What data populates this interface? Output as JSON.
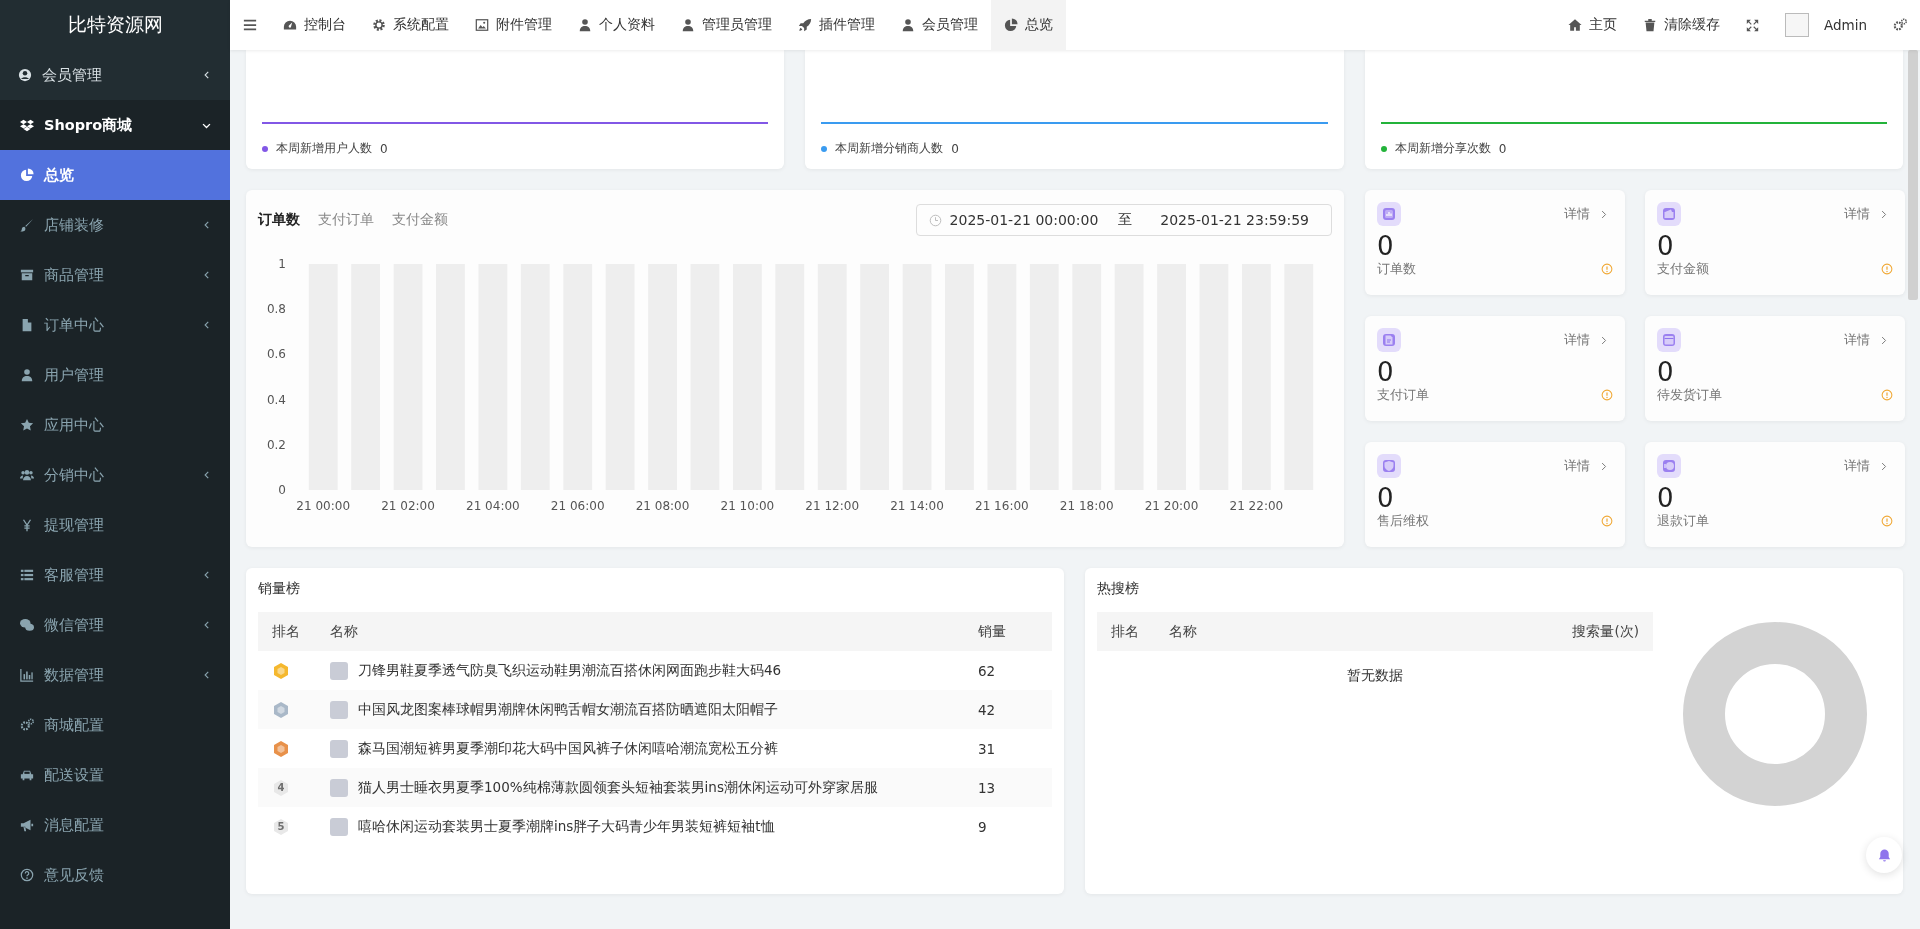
{
  "sidebar": {
    "logo": "比特资源网",
    "items": [
      {
        "label": "会员管理",
        "selected": false,
        "expanded": false
      },
      {
        "label": "Shopro商城",
        "selected": false,
        "expanded": true,
        "children": [
          {
            "label": "总览",
            "selected": true
          },
          {
            "label": "店铺装修",
            "selected": false,
            "expanded": false
          },
          {
            "label": "商品管理",
            "selected": false,
            "expanded": false
          },
          {
            "label": "订单中心",
            "selected": false,
            "expanded": false
          },
          {
            "label": "用户管理",
            "selected": false
          },
          {
            "label": "应用中心",
            "selected": false
          },
          {
            "label": "分销中心",
            "selected": false,
            "expanded": false
          },
          {
            "label": "提现管理",
            "selected": false
          },
          {
            "label": "客服管理",
            "selected": false,
            "expanded": false
          },
          {
            "label": "微信管理",
            "selected": false,
            "expanded": false
          },
          {
            "label": "数据管理",
            "selected": false,
            "expanded": false
          },
          {
            "label": "商城配置",
            "selected": false
          },
          {
            "label": "配送设置",
            "selected": false
          },
          {
            "label": "消息配置",
            "selected": false
          },
          {
            "label": "意见反馈",
            "selected": false
          }
        ]
      }
    ]
  },
  "nav": {
    "tabs": [
      {
        "label": "控制台",
        "selected": false
      },
      {
        "label": "系统配置",
        "selected": false
      },
      {
        "label": "附件管理",
        "selected": false
      },
      {
        "label": "个人资料",
        "selected": false
      },
      {
        "label": "管理员管理",
        "selected": false
      },
      {
        "label": "插件管理",
        "selected": false
      },
      {
        "label": "会员管理",
        "selected": false
      },
      {
        "label": "总览",
        "selected": true
      }
    ],
    "links": [
      "主页",
      "清除缓存"
    ],
    "user": "Admin"
  },
  "trend_cards": [
    {
      "legend": "本周新增用户人数",
      "value": "0",
      "color": "#8257e6"
    },
    {
      "legend": "本周新增分销商人数",
      "value": "0",
      "color": "#3a9bf0"
    },
    {
      "legend": "本周新增分享次数",
      "value": "0",
      "color": "#23b33a"
    }
  ],
  "order_chart": {
    "tabs": [
      {
        "label": "订单数",
        "selected": true
      },
      {
        "label": "支付订单",
        "selected": false
      },
      {
        "label": "支付金额",
        "selected": false
      }
    ],
    "date_range": {
      "start": "2025-01-21 00:00:00",
      "separator": "至",
      "end": "2025-01-21 23:59:59"
    },
    "chart_data": {
      "type": "bar",
      "categories": [
        "21 00:00",
        null,
        "21 02:00",
        null,
        "21 04:00",
        null,
        "21 06:00",
        null,
        "21 08:00",
        null,
        "21 10:00",
        null,
        "21 12:00",
        null,
        "21 14:00",
        null,
        "21 16:00",
        null,
        "21 18:00",
        null,
        "21 20:00",
        null,
        "21 22:00",
        null
      ],
      "series": [
        {
          "color": "#eeeeee",
          "values": [
            1,
            1,
            1,
            1,
            1,
            1,
            1,
            1,
            1,
            1,
            1,
            1,
            1,
            1,
            1,
            1,
            1,
            1,
            1,
            1,
            1,
            1,
            1,
            1
          ]
        },
        {
          "color": "#8f74ec",
          "values": [
            0,
            0,
            0,
            0,
            0,
            0,
            0,
            0,
            0,
            0,
            0,
            0,
            0,
            0,
            0,
            0,
            0,
            0,
            0,
            0,
            0,
            0,
            0,
            0
          ]
        }
      ],
      "ylim": [
        0,
        1
      ],
      "yticks": [
        0,
        0.2,
        0.4,
        0.6,
        0.8,
        1
      ]
    }
  },
  "stat_cards": [
    {
      "value": "0",
      "label": "订单数",
      "link": "详情"
    },
    {
      "value": "0",
      "label": "支付金额",
      "link": "详情"
    },
    {
      "value": "0",
      "label": "支付订单",
      "link": "详情"
    },
    {
      "value": "0",
      "label": "待发货订单",
      "link": "详情"
    },
    {
      "value": "0",
      "label": "售后维权",
      "link": "详情"
    },
    {
      "value": "0",
      "label": "退款订单",
      "link": "详情"
    }
  ],
  "sales_ranking": {
    "title": "销量榜",
    "columns": [
      "排名",
      "名称",
      "销量"
    ],
    "rows": [
      {
        "kind": "medal",
        "color": "#f5b82e",
        "name": "刀锋男鞋夏季透气防臭飞织运动鞋男潮流百搭休闲网面跑步鞋大码46",
        "sales": "62"
      },
      {
        "kind": "medal",
        "color": "#a9b8c8",
        "name": "中国风龙图案棒球帽男潮牌休闲鸭舌帽女潮流百搭防晒遮阳太阳帽子",
        "sales": "42"
      },
      {
        "kind": "medal",
        "color": "#e8914a",
        "name": "森马国潮短裤男夏季潮印花大码中国风裤子休闲嘻哈潮流宽松五分裤",
        "sales": "31"
      },
      {
        "kind": "number",
        "rank": "4",
        "name": "猫人男士睡衣男夏季100%纯棉薄款圆领套头短袖套装男ins潮休闲运动可外穿家居服",
        "sales": "13"
      },
      {
        "kind": "number",
        "rank": "5",
        "name": "嘻哈休闲运动套装男士夏季潮牌ins胖子大码青少年男装短裤短袖t恤",
        "sales": "9"
      }
    ]
  },
  "hot_search": {
    "title": "热搜榜",
    "columns": [
      "排名",
      "名称",
      "搜索量(次)"
    ],
    "empty_text": "暂无数据"
  }
}
